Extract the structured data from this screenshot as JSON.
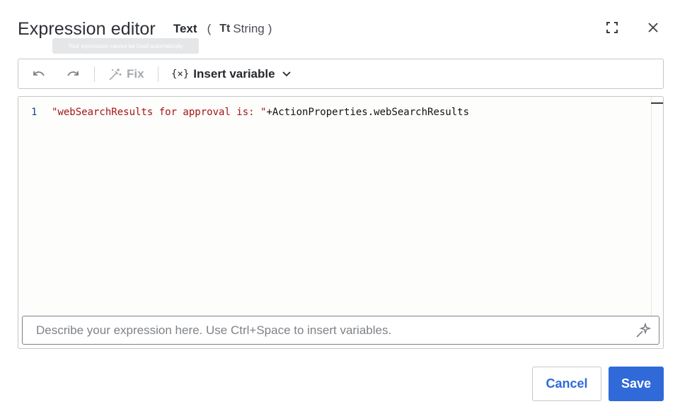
{
  "dialog": {
    "title": "Expression editor",
    "type_label": "Text",
    "paren_open": "(",
    "type_icon": "Tt",
    "type_value": "String",
    "paren_close": ")",
    "expand_icon": "expand-icon",
    "close_icon": "close-icon"
  },
  "tooltip": {
    "text": "Your expression cannot be fixed automatically"
  },
  "toolbar": {
    "undo_icon": "undo-icon",
    "redo_icon": "redo-icon",
    "fix_label": "Fix",
    "insert_glyph": "{×}",
    "insert_label": "Insert variable"
  },
  "editor": {
    "line_number": "1",
    "code_string": "\"webSearchResults for approval is: \"",
    "code_rest": "+ActionProperties.webSearchResults"
  },
  "prompt": {
    "placeholder": "Describe your expression here. Use Ctrl+Space to insert variables.",
    "value": ""
  },
  "footer": {
    "cancel_label": "Cancel",
    "save_label": "Save"
  },
  "colors": {
    "accent": "#2f6ad8",
    "string_literal": "#a31515",
    "line_number": "#1f3f8f",
    "disabled": "#a6a9ae"
  }
}
